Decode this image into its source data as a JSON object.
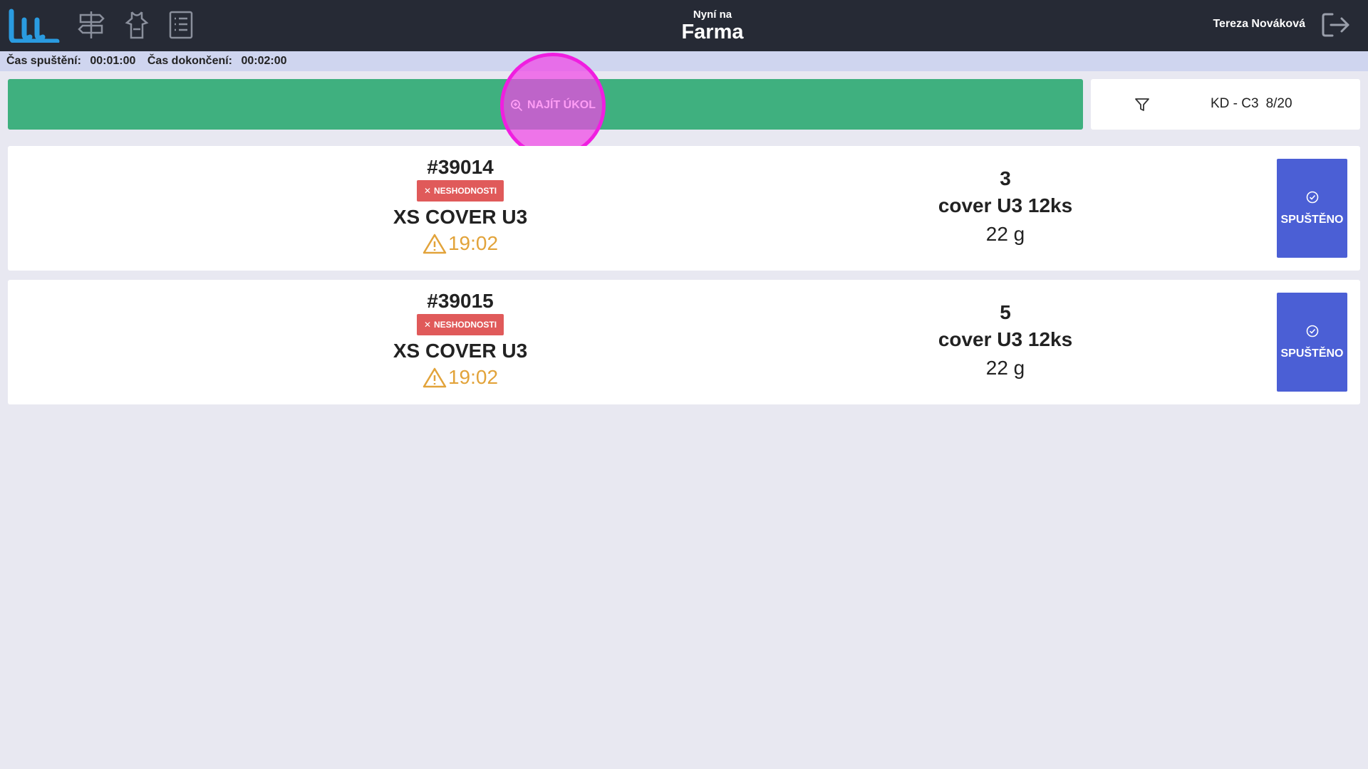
{
  "header": {
    "now_label": "Nyní na",
    "location": "Farma",
    "user_name": "Tereza Nováková"
  },
  "times": {
    "start_label": "Čas spuštění:",
    "start_value": "00:01:00",
    "finish_label": "Čas dokončení:",
    "finish_value": "00:02:00"
  },
  "find_task": {
    "label": "NAJÍT ÚKOL"
  },
  "filter": {
    "station": "KD - C3",
    "ratio": "8/20"
  },
  "tasks": [
    {
      "order": "#39014",
      "badge": "NESHODNOSTI",
      "product": "XS COVER U3",
      "due": "19:02",
      "qty": "3",
      "material": "cover U3 12ks",
      "weight": "22 g",
      "status": "SPUŠTĚNO"
    },
    {
      "order": "#39015",
      "badge": "NESHODNOSTI",
      "product": "XS COVER U3",
      "due": "19:02",
      "qty": "5",
      "material": "cover U3 12ks",
      "weight": "22 g",
      "status": "SPUŠTĚNO"
    }
  ],
  "colors": {
    "topbar": "#262a35",
    "accent_green": "#3fb07f",
    "badge_red": "#e05a5a",
    "warning_orange": "#e2a33a",
    "start_blue": "#4b5fd5",
    "highlight_magenta": "#f01ee0",
    "logo_blue": "#2a9be0"
  },
  "icons": {
    "logo": "app-logo",
    "nav": [
      "signpost-icon",
      "apron-icon",
      "list-icon"
    ],
    "logout": "logout-icon",
    "search": "search-zoom-icon",
    "filter": "filter-icon",
    "warning": "warning-icon",
    "check": "check-circle-icon"
  }
}
